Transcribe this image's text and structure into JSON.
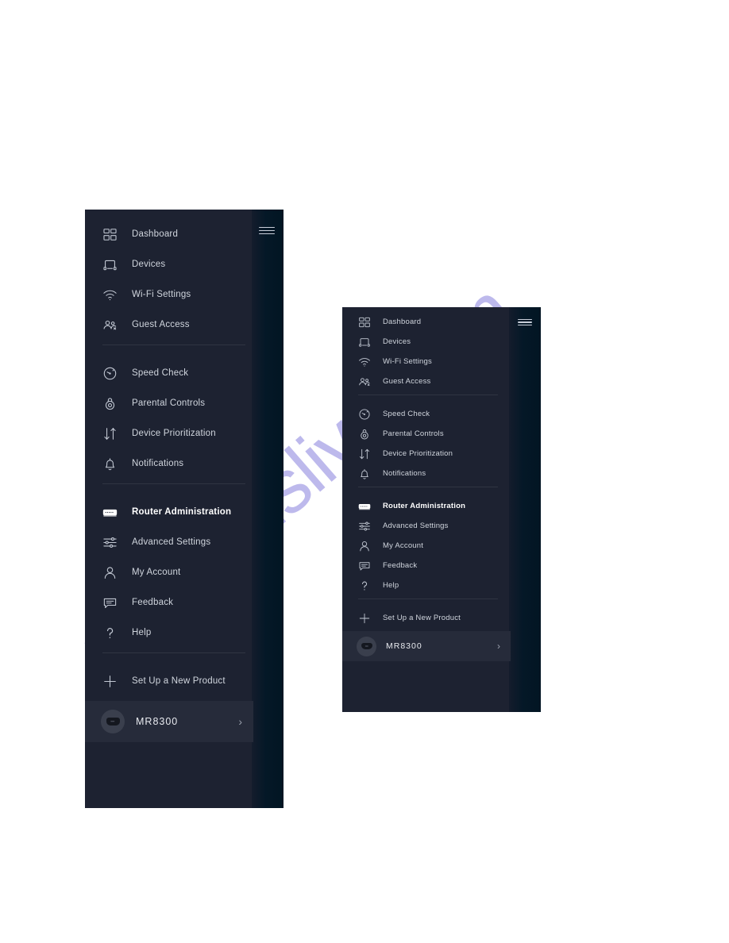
{
  "watermark": {
    "text": "manualslive.com",
    "color": "#382cc4"
  },
  "panels": [
    {
      "id": "large",
      "menu_groups": [
        {
          "items": [
            {
              "label": "Dashboard",
              "icon": "dashboard-icon",
              "active": false
            },
            {
              "label": "Devices",
              "icon": "devices-icon",
              "active": false
            },
            {
              "label": "Wi-Fi Settings",
              "icon": "wifi-icon",
              "active": false
            },
            {
              "label": "Guest Access",
              "icon": "guest-access-icon",
              "active": false
            }
          ]
        },
        {
          "items": [
            {
              "label": "Speed Check",
              "icon": "speedometer-icon",
              "active": false
            },
            {
              "label": "Parental Controls",
              "icon": "lock-icon",
              "active": false
            },
            {
              "label": "Device Prioritization",
              "icon": "up-down-arrows-icon",
              "active": false
            },
            {
              "label": "Notifications",
              "icon": "bell-icon",
              "active": false
            }
          ]
        },
        {
          "items": [
            {
              "label": "Router Administration",
              "icon": "router-icon",
              "active": true
            },
            {
              "label": "Advanced Settings",
              "icon": "sliders-icon",
              "active": false
            },
            {
              "label": "My Account",
              "icon": "person-icon",
              "active": false
            },
            {
              "label": "Feedback",
              "icon": "chat-bubble-icon",
              "active": false
            },
            {
              "label": "Help",
              "icon": "question-mark-icon",
              "active": false
            }
          ]
        },
        {
          "items": [
            {
              "label": "Set Up a New Product",
              "icon": "plus-icon",
              "active": false
            }
          ]
        }
      ],
      "device": {
        "name": "MR8300",
        "chevron": "›"
      },
      "menu_toggle": "hamburger-icon"
    },
    {
      "id": "small",
      "menu_groups": [
        {
          "items": [
            {
              "label": "Dashboard",
              "icon": "dashboard-icon",
              "active": false
            },
            {
              "label": "Devices",
              "icon": "devices-icon",
              "active": false
            },
            {
              "label": "Wi-Fi Settings",
              "icon": "wifi-icon",
              "active": false
            },
            {
              "label": "Guest Access",
              "icon": "guest-access-icon",
              "active": false
            }
          ]
        },
        {
          "items": [
            {
              "label": "Speed Check",
              "icon": "speedometer-icon",
              "active": false
            },
            {
              "label": "Parental Controls",
              "icon": "lock-icon",
              "active": false
            },
            {
              "label": "Device Prioritization",
              "icon": "up-down-arrows-icon",
              "active": false
            },
            {
              "label": "Notifications",
              "icon": "bell-icon",
              "active": false
            }
          ]
        },
        {
          "items": [
            {
              "label": "Router Administration",
              "icon": "router-icon",
              "active": true
            },
            {
              "label": "Advanced Settings",
              "icon": "sliders-icon",
              "active": false
            },
            {
              "label": "My Account",
              "icon": "person-icon",
              "active": false
            },
            {
              "label": "Feedback",
              "icon": "chat-bubble-icon",
              "active": false
            },
            {
              "label": "Help",
              "icon": "question-mark-icon",
              "active": false
            }
          ]
        },
        {
          "items": [
            {
              "label": "Set Up a New Product",
              "icon": "plus-icon",
              "active": false
            }
          ]
        }
      ],
      "device": {
        "name": "MR8300",
        "chevron": "›"
      },
      "menu_toggle": "hamburger-icon"
    }
  ]
}
